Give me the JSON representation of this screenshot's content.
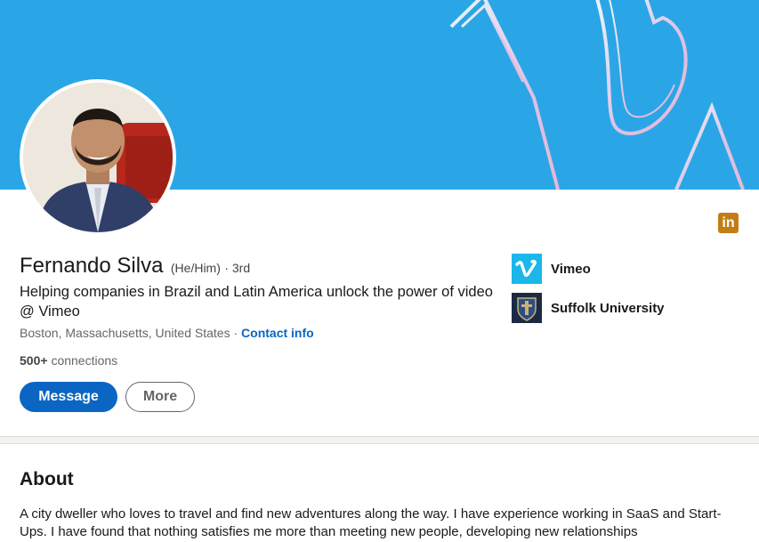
{
  "profile": {
    "name": "Fernando Silva",
    "pronouns": "(He/Him)",
    "degree": "· 3rd",
    "headline": "Helping companies in Brazil and Latin America unlock the power of video @ Vimeo",
    "location": "Boston, Massachusetts, United States",
    "location_separator": "·",
    "contact_label": "Contact info",
    "connections_count": "500+",
    "connections_label": "connections"
  },
  "actions": {
    "message_label": "Message",
    "more_label": "More"
  },
  "organizations": [
    {
      "name": "Vimeo",
      "icon": "vimeo-logo",
      "color": "#1ab7ea"
    },
    {
      "name": "Suffolk University",
      "icon": "suffolk-university-seal",
      "color": "#1c2a44"
    }
  ],
  "badge": {
    "icon": "linkedin-icon",
    "text": "in",
    "color": "#c37d16"
  },
  "about": {
    "title": "About",
    "text": "A city dweller who loves to travel and find new adventures along the way. I have experience working in SaaS and Start-Ups. I have found that nothing satisfies me more than meeting new people, developing new relationships"
  },
  "colors": {
    "banner": "#2aa6e6",
    "primary": "#0a66c2"
  }
}
